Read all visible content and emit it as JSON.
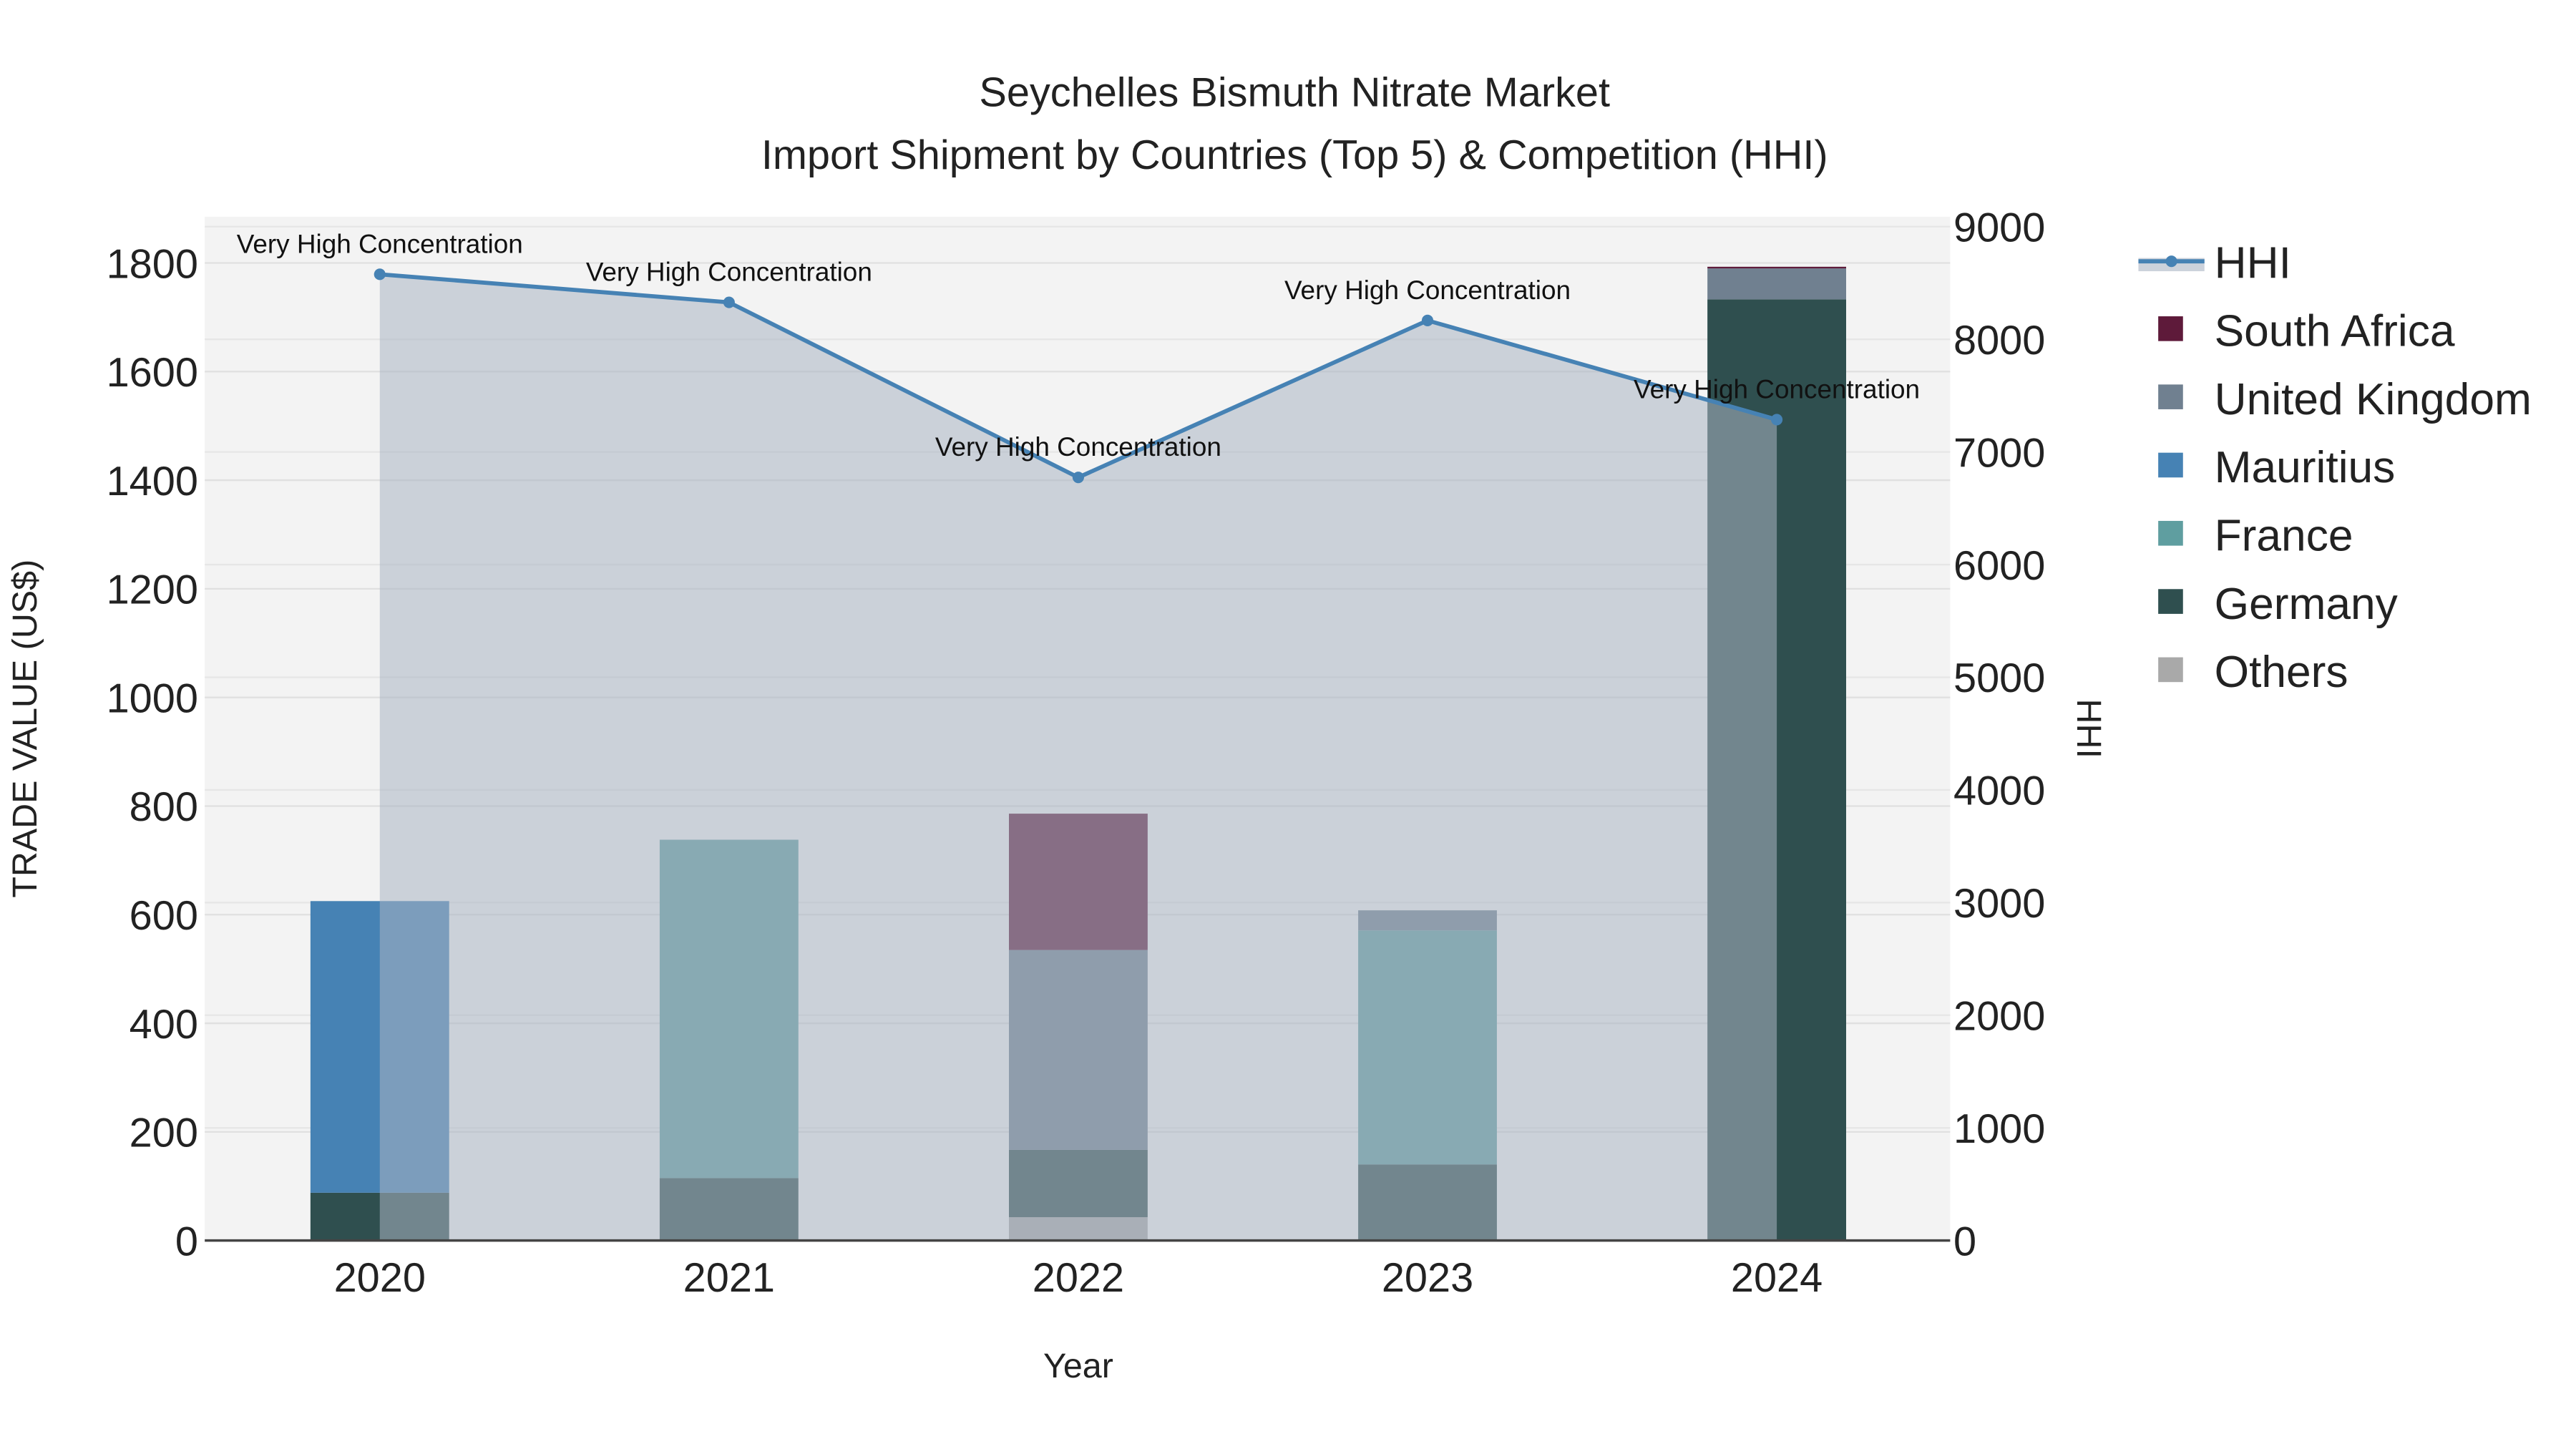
{
  "chart_data": {
    "type": "bar",
    "title": "Seychelles Bismuth Nitrate Market",
    "subtitle": "Import Shipment by Countries (Top 5) & Competition (HHI)",
    "xlabel": "Year",
    "ylabel": "TRADE VALUE (US$)",
    "y2label": "HHI",
    "categories": [
      "2020",
      "2021",
      "2022",
      "2023",
      "2024"
    ],
    "ylim": [
      0,
      1880
    ],
    "y2lim": [
      0,
      9180
    ],
    "yticks": [
      0,
      200,
      400,
      600,
      800,
      1000,
      1200,
      1400,
      1600,
      1800
    ],
    "y2ticks": [
      0,
      1000,
      2000,
      3000,
      4000,
      5000,
      6000,
      7000,
      8000,
      9000
    ],
    "stacked": true,
    "legend_position": "right",
    "series": [
      {
        "name": "Others",
        "color": "#A9A9A9",
        "values": [
          0,
          0,
          43,
          0,
          0
        ]
      },
      {
        "name": "Germany",
        "color": "#2F4F4F",
        "values": [
          88,
          115,
          124,
          140,
          1733
        ]
      },
      {
        "name": "France",
        "color": "#5F9EA0",
        "values": [
          0,
          623,
          0,
          431,
          0
        ]
      },
      {
        "name": "Mauritius",
        "color": "#4682B4",
        "values": [
          537,
          0,
          0,
          0,
          0
        ]
      },
      {
        "name": "United Kingdom",
        "color": "#708090",
        "values": [
          0,
          0,
          368,
          37,
          57
        ]
      },
      {
        "name": "South Africa",
        "color": "#5E1A3A",
        "values": [
          0,
          0,
          251,
          0,
          3
        ]
      }
    ],
    "line": {
      "name": "HHI",
      "color": "#4682B4",
      "values": [
        8577,
        8328,
        6774,
        8167,
        7287
      ]
    },
    "annotations": [
      "Very High Concentration",
      "Very High Concentration",
      "Very High Concentration",
      "Very High Concentration",
      "Very High Concentration"
    ],
    "legend": [
      "HHI",
      "South Africa",
      "United Kingdom",
      "Mauritius",
      "France",
      "Germany",
      "Others"
    ]
  }
}
